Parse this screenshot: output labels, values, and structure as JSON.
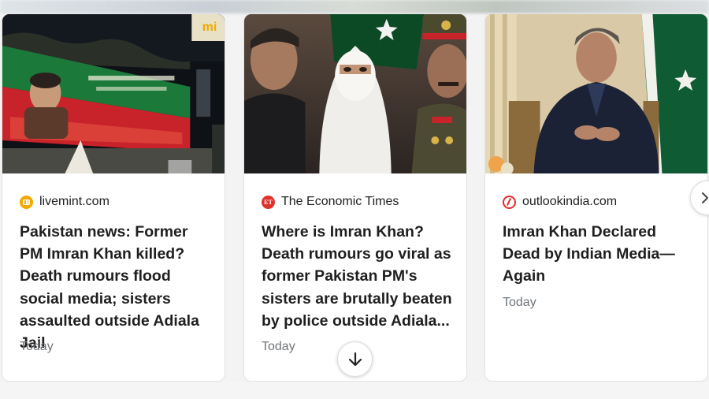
{
  "cards": [
    {
      "source": "livemint.com",
      "favicon_icon": "livemint-logo-icon",
      "favicon_color": "#f2a900",
      "title": "Pakistan news: Former PM Imran Khan killed? Death rumours flood social media; sisters assaulted outside Adiala Jail",
      "time": "Today"
    },
    {
      "source": "The Economic Times",
      "favicon_icon": "economic-times-logo-icon",
      "favicon_color": "#e0312b",
      "title": "Where is Imran Khan? Death rumours go viral as former Pakistan PM's sisters are brutally beaten by police outside Adiala...",
      "time": "Today"
    },
    {
      "source": "outlookindia.com",
      "favicon_icon": "outlookindia-logo-icon",
      "favicon_color": "#e32b2b",
      "title": "Imran Khan Declared Dead by Indian Media—Again",
      "time": "Today"
    }
  ],
  "thumb_badge_text": "mi",
  "controls": {
    "scroll_down_icon": "arrow-down-icon",
    "next_icon": "chevron-right-icon"
  },
  "colors": {
    "pti_green": "#1b7a3a",
    "pti_red": "#c8222a",
    "flag_green": "#01411c",
    "card_bg": "#ffffff",
    "meta_gray": "#70757a"
  }
}
